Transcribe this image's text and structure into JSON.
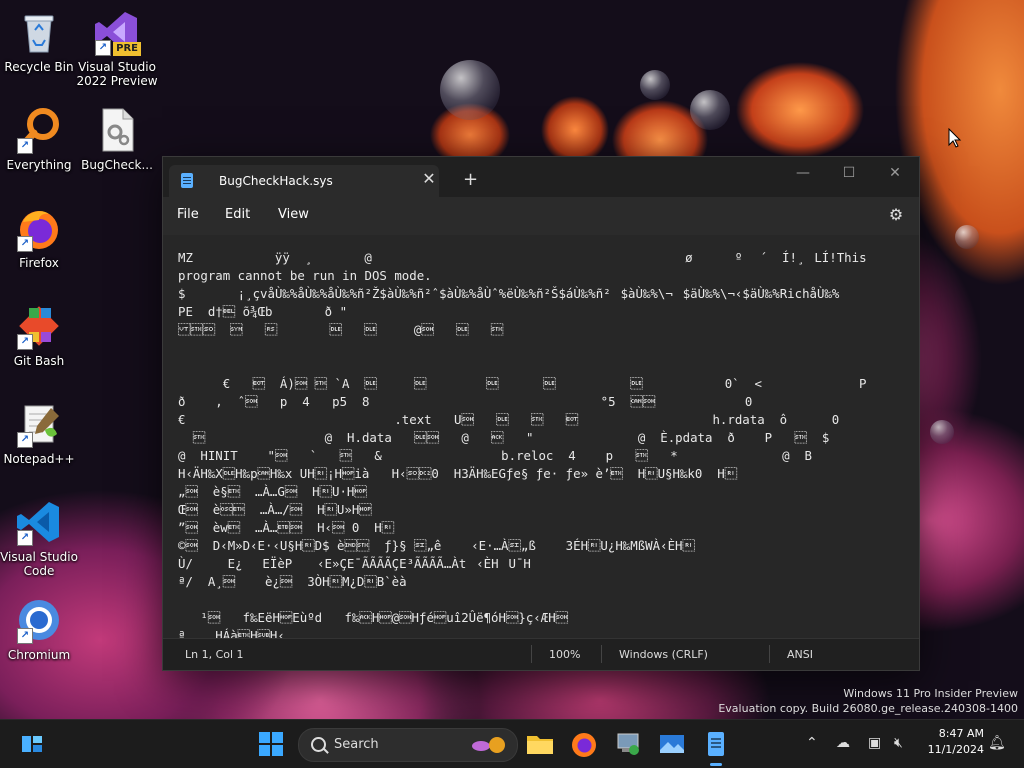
{
  "desktop": {
    "icons": [
      {
        "label": "Recycle Bin"
      },
      {
        "label": "Visual Studio 2022 Preview",
        "badge": "PRE"
      },
      {
        "label": "Everything"
      },
      {
        "label": "BugCheck..."
      },
      {
        "label": "Firefox"
      },
      {
        "label": "Git Bash"
      },
      {
        "label": "Notepad++"
      },
      {
        "label": "Visual Studio Code"
      },
      {
        "label": "Chromium"
      }
    ]
  },
  "notepad": {
    "tab_title": "BugCheckHack.sys",
    "tab_close": "✕",
    "new_tab": "+",
    "window_controls": {
      "minimize": "—",
      "maximize": "☐",
      "close": "✕"
    },
    "menu": {
      "file": "File",
      "edit": "Edit",
      "view": "View"
    },
    "content": "MZ \u0003   \u0004   ÿÿ  ¸       @                                          ø   \u000e\u001fº\u000e ´  Í!¸\u0001LÍ!This\nprogram cannot be run in DOS mode.\n$       ¡¸çvåÙ‰%åÙ‰%åÙ‰%ñ²Ž$àÙ‰%ñ²ˆ$àÙ‰%åÙˆ%ëÙ‰%ñ²Š$áÙ‰%ñ²$àÙ‰%\\¬$äÙ‰%\\¬‹$äÙ‰%RichåÙ‰%\nPE  d†\u0007 õ¾Œb       ð \"\n\u000b\u0002\u000e  \u0016   \u001e       \u0010   \u0010     @\u0001   \u0010   \u0002\n\n\n      €   \u0004  Á)\u0001 \u0002 `A  \u0010     \u0010        \u0010      \u0010          \u0010           0`  <             P\nð    ,  ˆ\u0001   p  4   p5  8                               °5  \u0018\u0001            0\n€                            .text   U\u0001   \u0010   \u0002   \u0004                  h.rdata  ô      0\n  \u0002                @  H.data   \u0010\u0001   @   \u0006   \"              @  È.pdata  ð    P   \u0002  $\n@  HINIT    \"\u0001   `   \u0002   &                b.reloc  4    p   \u0002   *              @  B\nH‹ÄH‰X\u0010H‰p\u0018H‰x UH¡Hià   H‹\u000e\u00120  H3ÄH‰EGƒe§ ƒe· ƒe» è’\u0003  HU§H‰k0  H\n„\u0001  è§\u0003  …À…G\u0001  HU·H\nŒ\u0001  è\u0003  …À…/\u0001  HU»H\n”\u0001  èw\u0003  …À…\u0017\u0001  H‹\u0001 0  H\n©\u0001  D‹M»D‹E·‹U§HD$ è\u0002  ƒ}§ \u000f„ê    ‹E·…À\u000f„ß    3ÉHU¿H‰MßWÀ‹ÈH\nÙ/  \u0001E¿\u000f\u0011EÏèP\u0001  ‹E»ÇE¯ÃÃÃÃÇE³ÃÃÃÃ…Àt\u0013‹ÈHU¯H\nª/  A¸\u0001    è¿\u0001  3ÒHM¿DB`èà\n\n   ¹\u0001   f‰EëHEùºd   f‰\u0006H@\u0001Hƒéuî2Ûë¶óH\u0001}ç‹ÆH\u0001\nª    HÁà\u0003H\u001aH‹"
  },
  "status": {
    "position": "Ln 1, Col 1",
    "zoom": "100%",
    "line_ending": "Windows (CRLF)",
    "encoding": "ANSI"
  },
  "watermark": {
    "line1": "Windows 11 Pro Insider Preview",
    "line2": "Evaluation copy. Build 26080.ge_release.240308-1400"
  },
  "taskbar": {
    "search_placeholder": "Search",
    "time": "8:47 AM",
    "date": "11/1/2024"
  },
  "colors": {
    "accent": "#5ab0ff",
    "window_bg": "#202020",
    "editor_bg": "#272727"
  }
}
